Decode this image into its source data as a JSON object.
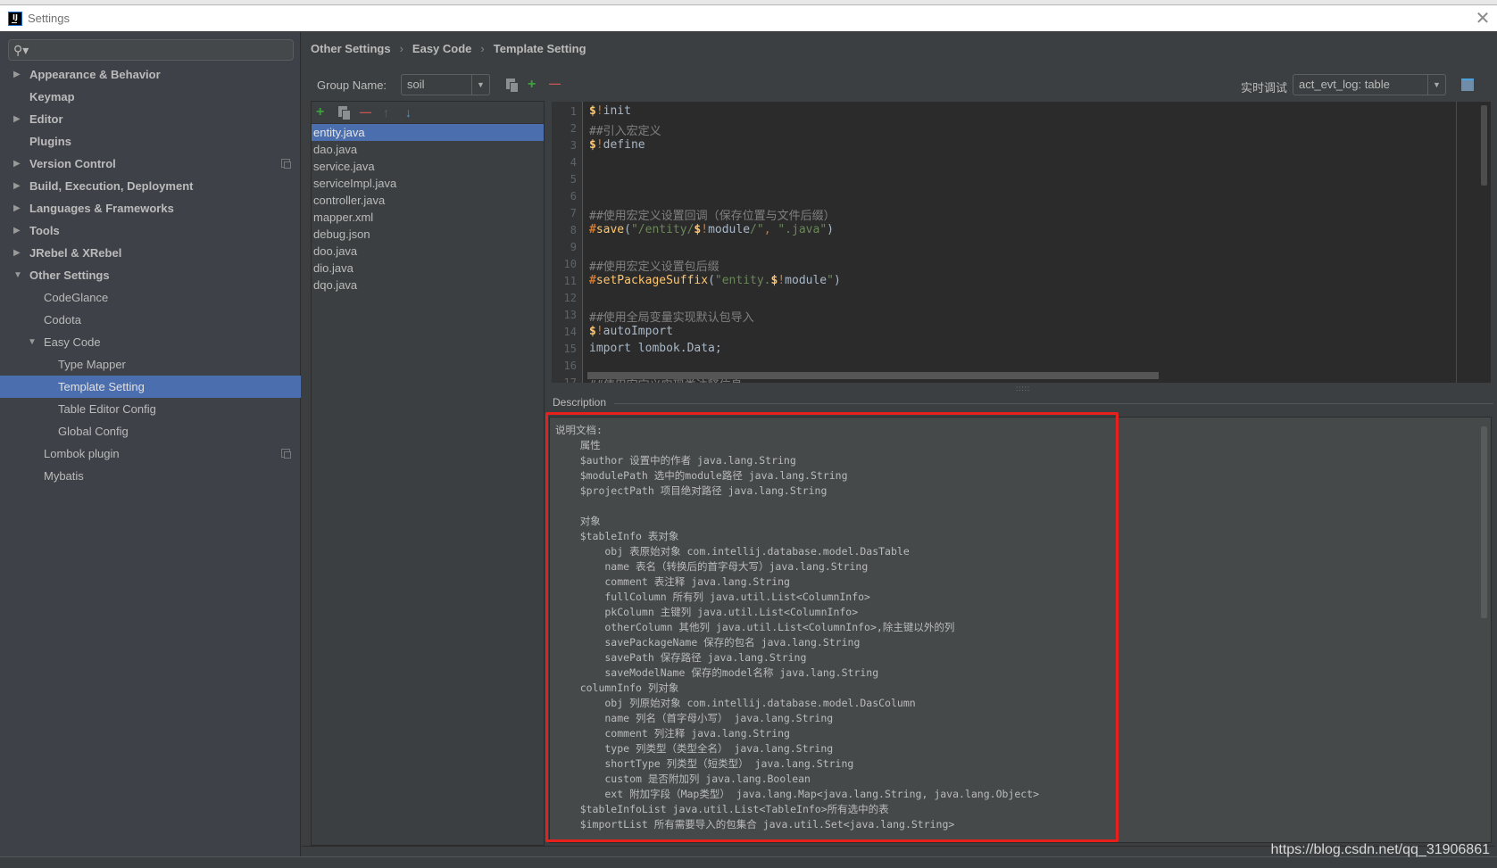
{
  "window": {
    "title": "Settings",
    "app_icon_text": "IJ",
    "close_glyph": "✕"
  },
  "sidebar": {
    "search_placeholder": "",
    "search_glyph": "🔍︎",
    "items": [
      {
        "label": "Appearance & Behavior",
        "level": 0,
        "bold": true,
        "arrow": "▶"
      },
      {
        "label": "Keymap",
        "level": 0,
        "bold": true,
        "arrow": ""
      },
      {
        "label": "Editor",
        "level": 0,
        "bold": true,
        "arrow": "▶"
      },
      {
        "label": "Plugins",
        "level": 0,
        "bold": true,
        "arrow": ""
      },
      {
        "label": "Version Control",
        "level": 0,
        "bold": true,
        "arrow": "▶",
        "badge": true
      },
      {
        "label": "Build, Execution, Deployment",
        "level": 0,
        "bold": true,
        "arrow": "▶"
      },
      {
        "label": "Languages & Frameworks",
        "level": 0,
        "bold": true,
        "arrow": "▶"
      },
      {
        "label": "Tools",
        "level": 0,
        "bold": true,
        "arrow": "▶"
      },
      {
        "label": "JRebel & XRebel",
        "level": 0,
        "bold": true,
        "arrow": "▶"
      },
      {
        "label": "Other Settings",
        "level": 0,
        "bold": true,
        "arrow": "▼"
      },
      {
        "label": "CodeGlance",
        "level": 1,
        "bold": false,
        "arrow": ""
      },
      {
        "label": "Codota",
        "level": 1,
        "bold": false,
        "arrow": ""
      },
      {
        "label": "Easy Code",
        "level": 1,
        "bold": false,
        "arrow": "▼"
      },
      {
        "label": "Type Mapper",
        "level": 2,
        "bold": false,
        "arrow": ""
      },
      {
        "label": "Template Setting",
        "level": 2,
        "bold": false,
        "arrow": "",
        "selected": true
      },
      {
        "label": "Table Editor Config",
        "level": 2,
        "bold": false,
        "arrow": ""
      },
      {
        "label": "Global Config",
        "level": 2,
        "bold": false,
        "arrow": ""
      },
      {
        "label": "Lombok plugin",
        "level": 1,
        "bold": false,
        "arrow": "",
        "badge": true
      },
      {
        "label": "Mybatis",
        "level": 1,
        "bold": false,
        "arrow": ""
      }
    ]
  },
  "breadcrumb": {
    "items": [
      "Other Settings",
      "Easy Code",
      "Template Setting"
    ],
    "separator": "›"
  },
  "group": {
    "label": "Group Name:",
    "value": "soil",
    "add_glyph": "+",
    "remove_glyph": "—"
  },
  "realtime_debug": {
    "label": "实时调试",
    "value": "act_evt_log: table"
  },
  "template_list": {
    "toolbar": {
      "add": "+",
      "remove": "—",
      "up": "🡅",
      "down": "🡇"
    },
    "items": [
      "entity.java",
      "dao.java",
      "service.java",
      "serviceImpl.java",
      "controller.java",
      "mapper.xml",
      "debug.json",
      "doo.java",
      "dio.java",
      "dqo.java"
    ],
    "selected_index": 0
  },
  "editor": {
    "lines": [
      {
        "n": "1",
        "parts": [
          [
            "dollar",
            "$"
          ],
          [
            "bang",
            "!"
          ],
          [
            "plain",
            "init"
          ]
        ]
      },
      {
        "n": "2",
        "parts": [
          [
            "comment",
            "##引入宏定义"
          ]
        ]
      },
      {
        "n": "3",
        "parts": [
          [
            "dollar",
            "$"
          ],
          [
            "bang",
            "!"
          ],
          [
            "plain",
            "define"
          ]
        ]
      },
      {
        "n": "4",
        "parts": []
      },
      {
        "n": "5",
        "parts": []
      },
      {
        "n": "6",
        "parts": []
      },
      {
        "n": "7",
        "parts": [
          [
            "comment",
            "##使用宏定义设置回调（保存位置与文件后缀）"
          ]
        ]
      },
      {
        "n": "8",
        "parts": [
          [
            "dir",
            "#"
          ],
          [
            "fn",
            "save"
          ],
          [
            "plain",
            "("
          ],
          [
            "str",
            "\"/entity/"
          ],
          [
            "dollar",
            "$"
          ],
          [
            "bang",
            "!"
          ],
          [
            "plain",
            "module"
          ],
          [
            "str",
            "/\""
          ],
          [
            "bang",
            ", "
          ],
          [
            "str",
            "\".java\""
          ],
          [
            "plain",
            ")"
          ]
        ]
      },
      {
        "n": "9",
        "parts": []
      },
      {
        "n": "10",
        "parts": [
          [
            "comment",
            "##使用宏定义设置包后缀"
          ]
        ]
      },
      {
        "n": "11",
        "parts": [
          [
            "dir",
            "#"
          ],
          [
            "fn",
            "setPackageSuffix"
          ],
          [
            "plain",
            "("
          ],
          [
            "str",
            "\"entity."
          ],
          [
            "dollar",
            "$"
          ],
          [
            "bang",
            "!"
          ],
          [
            "plain",
            "module"
          ],
          [
            "str",
            "\""
          ],
          [
            "plain",
            ")"
          ]
        ]
      },
      {
        "n": "12",
        "parts": []
      },
      {
        "n": "13",
        "parts": [
          [
            "comment",
            "##使用全局变量实现默认包导入"
          ]
        ]
      },
      {
        "n": "14",
        "parts": [
          [
            "dollar",
            "$"
          ],
          [
            "bang",
            "!"
          ],
          [
            "plain",
            "autoImport"
          ]
        ]
      },
      {
        "n": "15",
        "parts": [
          [
            "plain",
            "import lombok.Data;"
          ]
        ]
      },
      {
        "n": "16",
        "parts": []
      },
      {
        "n": "17",
        "parts": [
          [
            "comment",
            "##使用宏定义实现类注释信息"
          ]
        ]
      }
    ]
  },
  "description": {
    "label": "Description",
    "lines": [
      "说明文档:",
      "    属性",
      "    $author 设置中的作者 java.lang.String",
      "    $modulePath 选中的module路径 java.lang.String",
      "    $projectPath 项目绝对路径 java.lang.String",
      "",
      "    对象",
      "    $tableInfo 表对象",
      "        obj 表原始对象 com.intellij.database.model.DasTable",
      "        name 表名（转换后的首字母大写）java.lang.String",
      "        comment 表注释 java.lang.String",
      "        fullColumn 所有列 java.util.List<ColumnInfo>",
      "        pkColumn 主键列 java.util.List<ColumnInfo>",
      "        otherColumn 其他列 java.util.List<ColumnInfo>,除主键以外的列",
      "        savePackageName 保存的包名 java.lang.String",
      "        savePath 保存路径 java.lang.String",
      "        saveModelName 保存的model名称 java.lang.String",
      "    columnInfo 列对象",
      "        obj 列原始对象 com.intellij.database.model.DasColumn",
      "        name 列名（首字母小写） java.lang.String",
      "        comment 列注释 java.lang.String",
      "        type 列类型（类型全名） java.lang.String",
      "        shortType 列类型（短类型） java.lang.String",
      "        custom 是否附加列 java.lang.Boolean",
      "        ext 附加字段（Map类型） java.lang.Map<java.lang.String, java.lang.Object>",
      "    $tableInfoList java.util.List<TableInfo>所有选中的表",
      "    $importList 所有需要导入的包集合 java.util.Set<java.lang.String>"
    ]
  },
  "watermark": "https://blog.csdn.net/qq_31906861",
  "colors": {
    "accent_selection": "#4b6eaf",
    "highlight_box": "#e8201c",
    "add_green": "#3ca13b",
    "remove_red": "#c75450",
    "down_blue": "#3d9ad9"
  }
}
